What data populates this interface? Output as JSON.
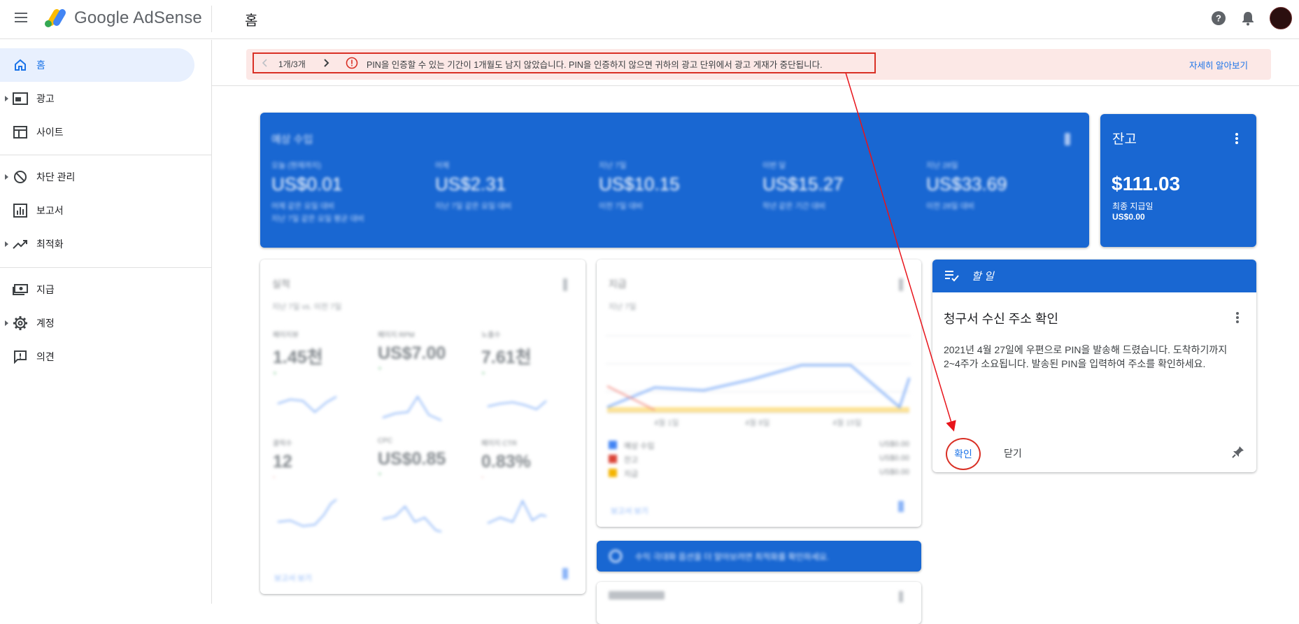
{
  "topbar": {
    "brand": "Google AdSense",
    "page_title": "홈"
  },
  "sidebar": {
    "items": [
      {
        "label": "홈",
        "active": true,
        "icon": "home-icon"
      },
      {
        "label": "광고",
        "icon": "ads-icon"
      },
      {
        "label": "사이트",
        "icon": "sites-icon"
      },
      {
        "label": "차단 관리",
        "icon": "block-icon"
      },
      {
        "label": "보고서",
        "icon": "reports-icon"
      },
      {
        "label": "최적화",
        "icon": "optimize-icon"
      },
      {
        "label": "지급",
        "icon": "payments-icon"
      },
      {
        "label": "계정",
        "icon": "gear-icon"
      },
      {
        "label": "의견",
        "icon": "feedback-icon"
      }
    ]
  },
  "alert": {
    "page": "1개/3개",
    "message": "PIN을 인증할 수 있는 기간이 1개월도 남지 않았습니다. PIN을 인증하지 않으면 귀하의 광고 단위에서 광고 게재가 중단됩니다.",
    "link": "자세히 알아보기"
  },
  "revenue": {
    "title": "예상 수입",
    "columns": [
      {
        "label": "오늘 (현재까지)",
        "value": "US$0.01",
        "sub1": "어제 같은 요일 대비",
        "sub2": "지난 7일 같은 요일 평균 대비"
      },
      {
        "label": "어제",
        "value": "US$2.31",
        "sub1": "지난 7일 같은 요일 대비",
        "sub2": ""
      },
      {
        "label": "지난 7일",
        "value": "US$10.15",
        "sub1": "이전 7일 대비",
        "sub2": ""
      },
      {
        "label": "이번 달",
        "value": "US$15.27",
        "sub1": "작년 같은 기간 대비",
        "sub2": ""
      },
      {
        "label": "지난 28일",
        "value": "US$33.69",
        "sub1": "이전 28일 대비",
        "sub2": ""
      }
    ]
  },
  "balance": {
    "title": "잔고",
    "amount": "$111.03",
    "label": "최종 지급일",
    "value": "US$0.00"
  },
  "todo": {
    "header": "할 일",
    "title": "청구서 수신 주소 확인",
    "body": "2021년 4월 27일에 우편으로 PIN을 발송해 드렸습니다. 도착하기까지 2~4주가 소요됩니다. 발송된 PIN을 입력하여 주소를 확인하세요.",
    "confirm": "확인",
    "close": "닫기"
  },
  "performance": {
    "title": "실적",
    "subtitle": "지난 7일 vs. 이전 7일",
    "metrics": [
      {
        "label": "페이지뷰",
        "value": "1.45천",
        "change": "+",
        "tone": "up"
      },
      {
        "label": "페이지 RPM",
        "value": "US$7.00",
        "change": "+",
        "tone": "up"
      },
      {
        "label": "노출수",
        "value": "7.61천",
        "change": "+",
        "tone": "up"
      },
      {
        "label": "클릭수",
        "value": "12",
        "change": "-",
        "tone": "down"
      },
      {
        "label": "CPC",
        "value": "US$0.85",
        "change": "+",
        "tone": "up"
      },
      {
        "label": "페이지 CTR",
        "value": "0.83%",
        "change": "-",
        "tone": "down"
      }
    ],
    "link": "보고서 보기"
  },
  "payments_card": {
    "title": "지급",
    "subtitle": "지난 7일",
    "x_labels": [
      "4월 1일",
      "4월 8일",
      "4월 15일"
    ],
    "legend": [
      {
        "name": "예상 수입",
        "value": "US$0.00",
        "color": "#4285f4"
      },
      {
        "name": "잔고",
        "value": "US$0.00",
        "color": "#db4437"
      },
      {
        "name": "지급",
        "value": "US$0.00",
        "color": "#f4b400"
      }
    ],
    "link": "보고서 보기"
  },
  "tip_card": {
    "text": "수익 극대화 옵션을 더 알아보려면 최적화를 확인하세요."
  },
  "colors": {
    "accent": "#1a73e8",
    "card_blue": "#1967d2",
    "alert_bg": "#fce8e6",
    "annotation_red": "#d93025"
  }
}
